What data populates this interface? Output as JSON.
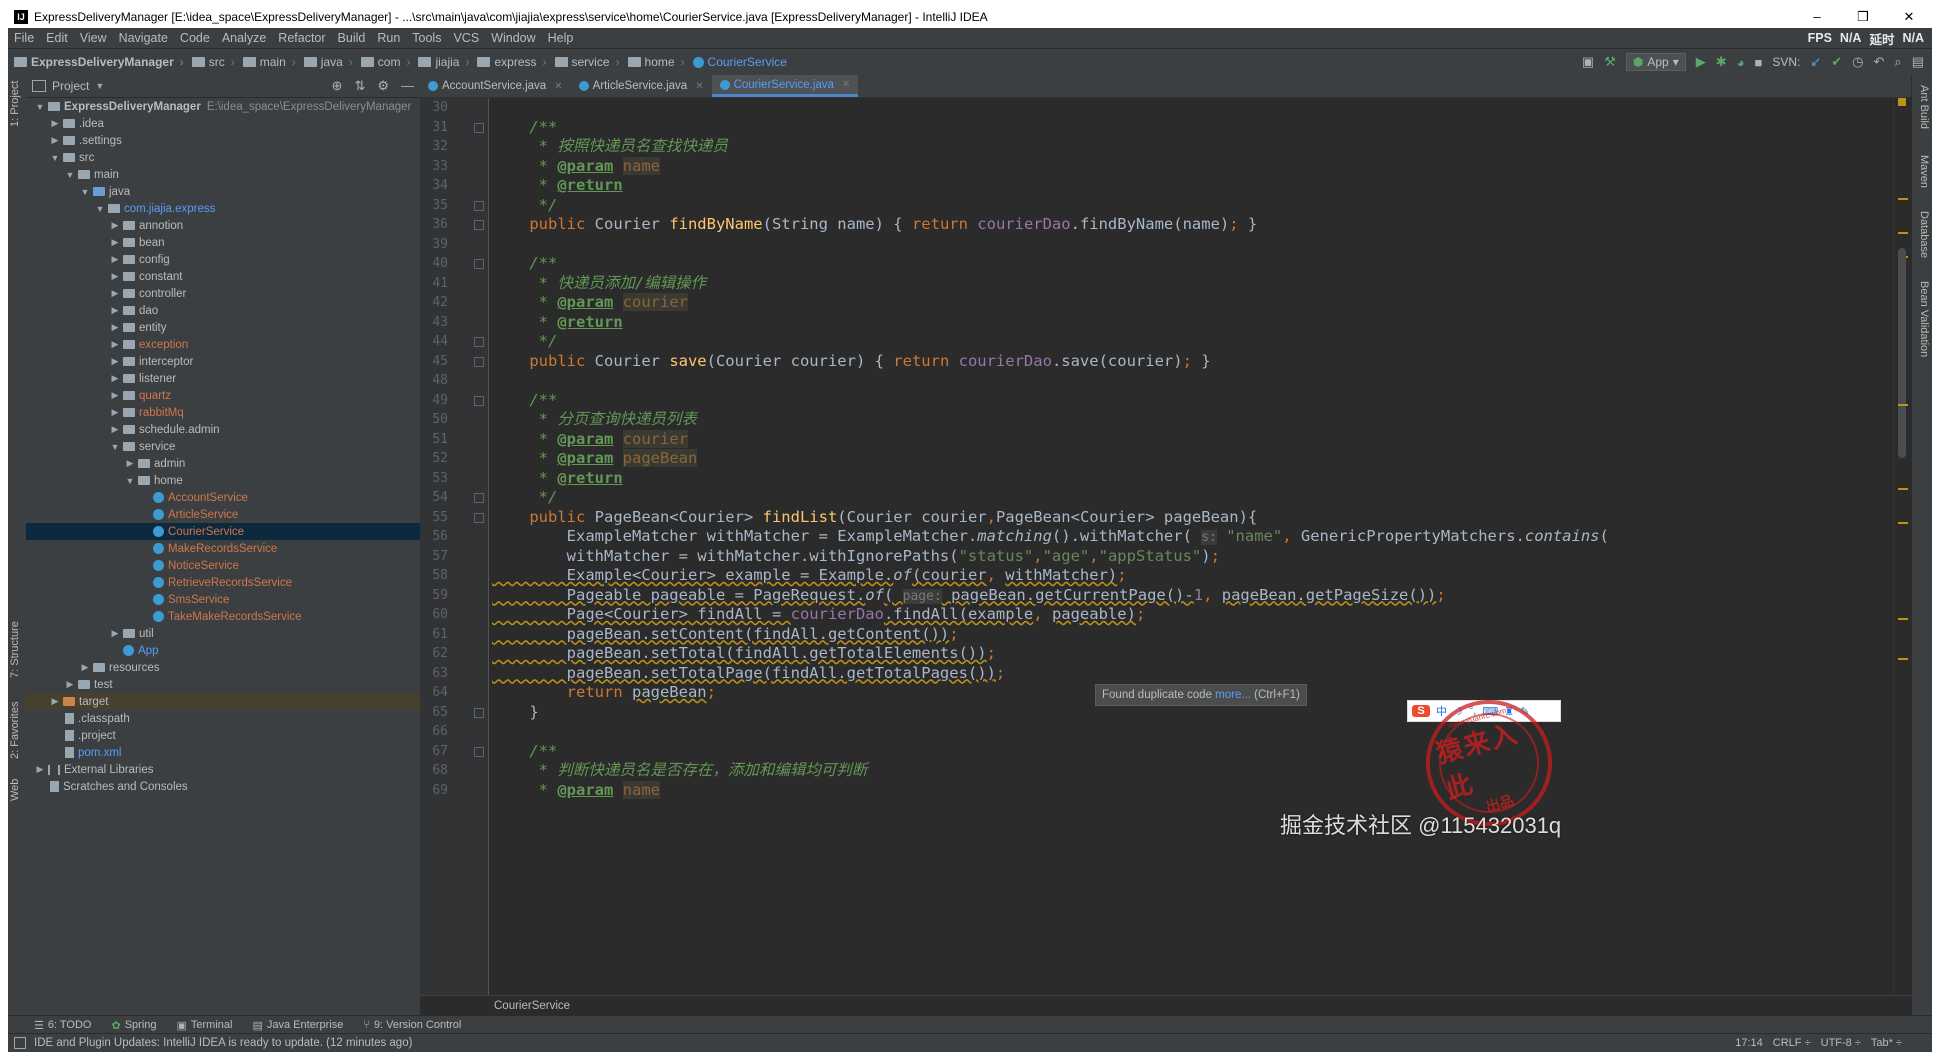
{
  "window": {
    "title": "ExpressDeliveryManager [E:\\idea_space\\ExpressDeliveryManager] - ...\\src\\main\\java\\com\\jiajia\\express\\service\\home\\CourierService.java [ExpressDeliveryManager] - IntelliJ IDEA",
    "app_icon": "IJ",
    "controls": [
      "–",
      "❒",
      "✕"
    ]
  },
  "menu": {
    "items": [
      "File",
      "Edit",
      "View",
      "Navigate",
      "Code",
      "Analyze",
      "Refactor",
      "Build",
      "Run",
      "Tools",
      "VCS",
      "Window",
      "Help"
    ],
    "status": [
      "FPS",
      "N/A",
      "延时",
      "N/A"
    ]
  },
  "breadcrumbs": [
    "ExpressDeliveryManager",
    "src",
    "main",
    "java",
    "com",
    "jiajia",
    "express",
    "service",
    "home",
    "CourierService"
  ],
  "toolbar": {
    "run_config": "App",
    "svn_label": "SVN:",
    "icons": [
      "build-icon",
      "hammer-icon",
      "run-icon",
      "debug-icon",
      "coverage-icon",
      "stop-icon",
      "svn-update-icon",
      "svn-commit-icon",
      "history-icon",
      "revert-icon",
      "search-icon",
      "settings-icon"
    ]
  },
  "left_stripe": {
    "project_tab": "1: Project",
    "structure_tab": "7: Structure",
    "favorites_tab": "2: Favorites",
    "web_tab": "Web"
  },
  "right_stripe": {
    "tabs": [
      "Ant Build",
      "Maven",
      "Database",
      "Bean Validation"
    ]
  },
  "project_panel": {
    "header": "Project",
    "tree": [
      {
        "label": "ExpressDeliveryManager",
        "extra": "E:\\idea_space\\ExpressDeliveryManager",
        "depth": 0,
        "arrow": "▼",
        "icon": "folder",
        "style": "bold"
      },
      {
        "label": ".idea",
        "depth": 1,
        "arrow": "▶",
        "icon": "folder"
      },
      {
        "label": ".settings",
        "depth": 1,
        "arrow": "▶",
        "icon": "folder"
      },
      {
        "label": "src",
        "depth": 1,
        "arrow": "▼",
        "icon": "folder"
      },
      {
        "label": "main",
        "depth": 2,
        "arrow": "▼",
        "icon": "folder"
      },
      {
        "label": "java",
        "depth": 3,
        "arrow": "▼",
        "icon": "folder-blue"
      },
      {
        "label": "com.jiajia.express",
        "depth": 4,
        "arrow": "▼",
        "icon": "folder",
        "style": "blue"
      },
      {
        "label": "annotion",
        "depth": 5,
        "arrow": "▶",
        "icon": "folder"
      },
      {
        "label": "bean",
        "depth": 5,
        "arrow": "▶",
        "icon": "folder"
      },
      {
        "label": "config",
        "depth": 5,
        "arrow": "▶",
        "icon": "folder"
      },
      {
        "label": "constant",
        "depth": 5,
        "arrow": "▶",
        "icon": "folder"
      },
      {
        "label": "controller",
        "depth": 5,
        "arrow": "▶",
        "icon": "folder"
      },
      {
        "label": "dao",
        "depth": 5,
        "arrow": "▶",
        "icon": "folder"
      },
      {
        "label": "entity",
        "depth": 5,
        "arrow": "▶",
        "icon": "folder"
      },
      {
        "label": "exception",
        "depth": 5,
        "arrow": "▶",
        "icon": "folder",
        "style": "orange"
      },
      {
        "label": "interceptor",
        "depth": 5,
        "arrow": "▶",
        "icon": "folder"
      },
      {
        "label": "listener",
        "depth": 5,
        "arrow": "▶",
        "icon": "folder"
      },
      {
        "label": "quartz",
        "depth": 5,
        "arrow": "▶",
        "icon": "folder",
        "style": "orange"
      },
      {
        "label": "rabbitMq",
        "depth": 5,
        "arrow": "▶",
        "icon": "folder",
        "style": "orange"
      },
      {
        "label": "schedule.admin",
        "depth": 5,
        "arrow": "▶",
        "icon": "folder"
      },
      {
        "label": "service",
        "depth": 5,
        "arrow": "▼",
        "icon": "folder"
      },
      {
        "label": "admin",
        "depth": 6,
        "arrow": "▶",
        "icon": "folder"
      },
      {
        "label": "home",
        "depth": 6,
        "arrow": "▼",
        "icon": "folder"
      },
      {
        "label": "AccountService",
        "depth": 7,
        "arrow": "",
        "icon": "class",
        "style": "orange"
      },
      {
        "label": "ArticleService",
        "depth": 7,
        "arrow": "",
        "icon": "class",
        "style": "orange"
      },
      {
        "label": "CourierService",
        "depth": 7,
        "arrow": "",
        "icon": "class",
        "style": "orange",
        "selected": true
      },
      {
        "label": "MakeRecordsService",
        "depth": 7,
        "arrow": "",
        "icon": "class",
        "style": "orange"
      },
      {
        "label": "NoticeService",
        "depth": 7,
        "arrow": "",
        "icon": "class",
        "style": "orange"
      },
      {
        "label": "RetrieveRecordsService",
        "depth": 7,
        "arrow": "",
        "icon": "class",
        "style": "orange"
      },
      {
        "label": "SmsService",
        "depth": 7,
        "arrow": "",
        "icon": "class",
        "style": "orange"
      },
      {
        "label": "TakeMakeRecordsService",
        "depth": 7,
        "arrow": "",
        "icon": "class",
        "style": "orange"
      },
      {
        "label": "util",
        "depth": 5,
        "arrow": "▶",
        "icon": "folder"
      },
      {
        "label": "App",
        "depth": 5,
        "arrow": "",
        "icon": "class",
        "style": "blue"
      },
      {
        "label": "resources",
        "depth": 3,
        "arrow": "▶",
        "icon": "folder"
      },
      {
        "label": "test",
        "depth": 2,
        "arrow": "▶",
        "icon": "folder"
      },
      {
        "label": "target",
        "depth": 1,
        "arrow": "▶",
        "icon": "folder-orange",
        "highlight": true
      },
      {
        "label": ".classpath",
        "depth": 1,
        "arrow": "",
        "icon": "file"
      },
      {
        "label": ".project",
        "depth": 1,
        "arrow": "",
        "icon": "file"
      },
      {
        "label": "pom.xml",
        "depth": 1,
        "arrow": "",
        "icon": "file",
        "style": "blue"
      },
      {
        "label": "External Libraries",
        "depth": 0,
        "arrow": "▶",
        "icon": "lib"
      },
      {
        "label": "Scratches and Consoles",
        "depth": 0,
        "arrow": "",
        "icon": "file"
      }
    ]
  },
  "editor": {
    "tabs": [
      {
        "label": "AccountService.java",
        "active": false
      },
      {
        "label": "ArticleService.java",
        "active": false
      },
      {
        "label": "CourierService.java",
        "active": true
      }
    ],
    "line_numbers": [
      "30",
      "31",
      "32",
      "33",
      "34",
      "35",
      "36",
      "39",
      "40",
      "41",
      "42",
      "43",
      "44",
      "45",
      "48",
      "49",
      "50",
      "51",
      "52",
      "53",
      "54",
      "55",
      "56",
      "57",
      "58",
      "59",
      "60",
      "61",
      "62",
      "63",
      "64",
      "65",
      "66",
      "67",
      "68",
      "69"
    ],
    "code_lines": [
      [],
      [
        [
          "cm",
          "    /**"
        ]
      ],
      [
        [
          "cm",
          "     * 按照快递员名查找快递员"
        ]
      ],
      [
        [
          "cm",
          "     * "
        ],
        [
          "tag",
          "@param"
        ],
        [
          "cm",
          " "
        ],
        [
          "param",
          "name"
        ]
      ],
      [
        [
          "cm",
          "     * "
        ],
        [
          "tag",
          "@return"
        ]
      ],
      [
        [
          "cm",
          "     */"
        ]
      ],
      [
        [
          "",
          "    "
        ],
        [
          "kw",
          "public "
        ],
        [
          "",
          "Courier "
        ],
        [
          "fn",
          "findByName"
        ],
        [
          "",
          "(String name) { "
        ],
        [
          "kw",
          "return "
        ],
        [
          "field",
          "courierDao"
        ],
        [
          "",
          ".findByName(name)"
        ],
        [
          "kw",
          ";"
        ],
        [
          "",
          " }"
        ]
      ],
      [],
      [
        [
          "cm",
          "    /**"
        ]
      ],
      [
        [
          "cm",
          "     * 快递员添加/编辑操作"
        ]
      ],
      [
        [
          "cm",
          "     * "
        ],
        [
          "tag",
          "@param"
        ],
        [
          "cm",
          " "
        ],
        [
          "param",
          "courier"
        ]
      ],
      [
        [
          "cm",
          "     * "
        ],
        [
          "tag",
          "@return"
        ]
      ],
      [
        [
          "cm",
          "     */"
        ]
      ],
      [
        [
          "",
          "    "
        ],
        [
          "kw",
          "public "
        ],
        [
          "",
          "Courier "
        ],
        [
          "fn",
          "save"
        ],
        [
          "",
          "(Courier courier) { "
        ],
        [
          "kw",
          "return "
        ],
        [
          "field",
          "courierDao"
        ],
        [
          "",
          ".save(courier)"
        ],
        [
          "kw",
          ";"
        ],
        [
          "",
          " }"
        ]
      ],
      [],
      [
        [
          "cm",
          "    /**"
        ]
      ],
      [
        [
          "cm",
          "     * 分页查询快递员列表"
        ]
      ],
      [
        [
          "cm",
          "     * "
        ],
        [
          "tag",
          "@param"
        ],
        [
          "cm",
          " "
        ],
        [
          "param",
          "courier"
        ]
      ],
      [
        [
          "cm",
          "     * "
        ],
        [
          "tag",
          "@param"
        ],
        [
          "cm",
          " "
        ],
        [
          "param",
          "pageBean"
        ]
      ],
      [
        [
          "cm",
          "     * "
        ],
        [
          "tag",
          "@return"
        ]
      ],
      [
        [
          "cm",
          "     */"
        ]
      ],
      [
        [
          "",
          "    "
        ],
        [
          "kw",
          "public "
        ],
        [
          "",
          "PageBean<Courier> "
        ],
        [
          "fn",
          "findList"
        ],
        [
          "",
          "(Courier courier"
        ],
        [
          "kw",
          ","
        ],
        [
          "",
          "PageBean<Courier> pageBean){"
        ]
      ],
      [
        [
          "",
          "        ExampleMatcher withMatcher = ExampleMatcher."
        ],
        [
          "it",
          "matching"
        ],
        [
          "",
          "().withMatcher( "
        ],
        [
          "hint",
          "s:"
        ],
        [
          "str",
          " \"name\""
        ],
        [
          "kw",
          ", "
        ],
        [
          "",
          "GenericPropertyMatchers."
        ],
        [
          "it",
          "contains"
        ],
        [
          "",
          "("
        ]
      ],
      [
        [
          "",
          "        withMatcher = withMatcher.withIgnorePaths("
        ],
        [
          "str",
          "\"status\""
        ],
        [
          "kw",
          ","
        ],
        [
          "str",
          "\"age\""
        ],
        [
          "kw",
          ","
        ],
        [
          "str",
          "\"appStatus\""
        ],
        [
          "",
          ")"
        ],
        [
          "kw",
          ";"
        ]
      ],
      [
        [
          "dup",
          "        Example<Courier> example = Example."
        ],
        [
          "it",
          "of"
        ],
        [
          "dup",
          "(courier"
        ],
        [
          "kw",
          ", "
        ],
        [
          "dup",
          "withMatcher)"
        ],
        [
          "kw",
          ";"
        ]
      ],
      [
        [
          "dup",
          "        Pageable pageable = PageRequest."
        ],
        [
          "it",
          "of"
        ],
        [
          "dup",
          "( "
        ],
        [
          "hint",
          "page:"
        ],
        [
          "dup",
          " pageBean.getCurrentPage()-"
        ],
        [
          "field",
          "1"
        ],
        [
          "kw",
          ", "
        ],
        [
          "dup",
          "pageBean.getPageSize())"
        ],
        [
          "kw",
          ";"
        ]
      ],
      [
        [
          "dup",
          "        Page<Courier> findAll = "
        ],
        [
          "field",
          "courierDao"
        ],
        [
          "dup",
          ".findAll(example"
        ],
        [
          "kw",
          ", "
        ],
        [
          "dup",
          "pageable)"
        ],
        [
          "kw",
          ";"
        ]
      ],
      [
        [
          "dup",
          "        pageBean.setContent(findAll.getContent())"
        ],
        [
          "kw",
          ";"
        ]
      ],
      [
        [
          "dup",
          "        pageBean.setTotal(findAll.getTotalElements())"
        ],
        [
          "kw",
          ";"
        ]
      ],
      [
        [
          "dup",
          "        pageBean.setTotalPage(findAll.getTotalPages())"
        ],
        [
          "kw",
          ";"
        ]
      ],
      [
        [
          "",
          "        "
        ],
        [
          "kw",
          "return "
        ],
        [
          "dup",
          "pageBean"
        ],
        [
          "kw",
          ";"
        ]
      ],
      [
        [
          "",
          "    }"
        ]
      ],
      [],
      [
        [
          "cm",
          "    /**"
        ]
      ],
      [
        [
          "cm",
          "     * 判断快递员名是否存在，添加和编辑均可判断"
        ]
      ],
      [
        [
          "cm",
          "     * "
        ],
        [
          "tag",
          "@param"
        ],
        [
          "cm",
          " "
        ],
        [
          "param",
          "name"
        ]
      ]
    ],
    "footer_breadcrumb": "CourierService",
    "tooltip": {
      "text": "Found duplicate code ",
      "link": "more...",
      "shortcut": " (Ctrl+F1)"
    }
  },
  "bottom_tools": [
    {
      "label": "6: TODO",
      "icon": "todo-icon",
      "glyph": "☰"
    },
    {
      "label": "Spring",
      "icon": "spring-icon",
      "glyph": "✿"
    },
    {
      "label": "Terminal",
      "icon": "terminal-icon",
      "glyph": "▣"
    },
    {
      "label": "Java Enterprise",
      "icon": "java-enterprise-icon",
      "glyph": "▤"
    },
    {
      "label": "9: Version Control",
      "icon": "version-control-icon",
      "glyph": "⑂"
    }
  ],
  "status_bar": {
    "message": "IDE and Plugin Updates: IntelliJ IDEA is ready to update. (12 minutes ago)",
    "position": "17:14",
    "line_sep": "CRLF ÷",
    "encoding": "UTF-8 ÷",
    "indent": "Tab* ÷"
  },
  "overlay": {
    "ime_logo": "S",
    "ime_text": "中",
    "stamp_url": "www.yuanrc.com",
    "stamp_main": "猿来入此",
    "stamp_sub": "出品",
    "watermark": "掘金技术社区 @115432031q"
  },
  "colors": {
    "background": "#2b2b2b",
    "panel": "#3c3f41",
    "keyword": "#cc7832",
    "comment": "#629755",
    "function": "#ffc66d",
    "field": "#9876aa",
    "string": "#6a8759",
    "selection": "#0d293e",
    "accent": "#589df6"
  }
}
